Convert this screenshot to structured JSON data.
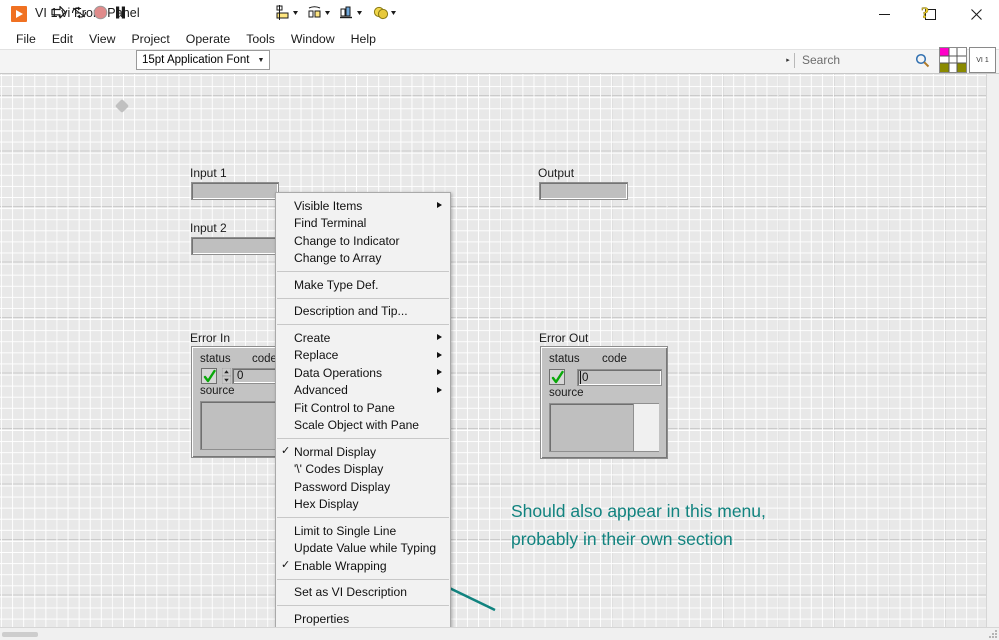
{
  "window": {
    "title": "VI 1.vi Front Panel",
    "app_icon": "labview-run-icon",
    "minimize_label": "Minimize",
    "maximize_label": "Maximize",
    "close_label": "Close"
  },
  "menubar": {
    "items": [
      {
        "label": "File"
      },
      {
        "label": "Edit"
      },
      {
        "label": "View"
      },
      {
        "label": "Project"
      },
      {
        "label": "Operate"
      },
      {
        "label": "Tools"
      },
      {
        "label": "Window"
      },
      {
        "label": "Help"
      }
    ]
  },
  "toolbar": {
    "run_label": "Run",
    "run_continuously_label": "Run Continuously",
    "abort_label": "Abort Execution",
    "pause_label": "Pause",
    "font_selector": {
      "value": "15pt Application Font",
      "caret": "▼"
    },
    "align_label": "Align Objects",
    "distribute_label": "Distribute Objects",
    "resize_label": "Resize Objects",
    "reorder_label": "Reorder",
    "search": {
      "placeholder": "Search",
      "expander": "▸"
    },
    "help_label": "Context Help",
    "connector_pane_label": "Connector Pane",
    "vi_icon_label": "VI 1"
  },
  "canvas": {
    "origin_marker": "origin-marker",
    "controls": [
      {
        "id": "input1",
        "label": "Input 1"
      },
      {
        "id": "input2",
        "label": "Input 2"
      },
      {
        "id": "output",
        "label": "Output"
      },
      {
        "id": "error_in",
        "label": "Error In"
      },
      {
        "id": "error_out",
        "label": "Error Out"
      }
    ],
    "error_in": {
      "label": "Error In",
      "status_label": "status",
      "code_label": "code",
      "source_label": "source",
      "code_value": "0",
      "status_value": "no error"
    },
    "error_out": {
      "label": "Error Out",
      "status_label": "status",
      "code_label": "code",
      "source_label": "source",
      "code_value": "0",
      "status_value": "no error"
    }
  },
  "context_menu": {
    "groups": [
      {
        "items": [
          {
            "label": "Visible Items",
            "submenu": true,
            "checked": false
          },
          {
            "label": "Find Terminal",
            "submenu": false,
            "checked": false
          },
          {
            "label": "Change to Indicator",
            "submenu": false,
            "checked": false
          },
          {
            "label": "Change to Array",
            "submenu": false,
            "checked": false
          }
        ]
      },
      {
        "items": [
          {
            "label": "Make Type Def.",
            "submenu": false,
            "checked": false
          }
        ]
      },
      {
        "items": [
          {
            "label": "Description and Tip...",
            "submenu": false,
            "checked": false
          }
        ]
      },
      {
        "items": [
          {
            "label": "Create",
            "submenu": true,
            "checked": false
          },
          {
            "label": "Replace",
            "submenu": true,
            "checked": false
          },
          {
            "label": "Data Operations",
            "submenu": true,
            "checked": false
          },
          {
            "label": "Advanced",
            "submenu": true,
            "checked": false
          },
          {
            "label": "Fit Control to Pane",
            "submenu": false,
            "checked": false
          },
          {
            "label": "Scale Object with Pane",
            "submenu": false,
            "checked": false
          }
        ]
      },
      {
        "items": [
          {
            "label": "Normal Display",
            "submenu": false,
            "checked": true
          },
          {
            "label": "'\\' Codes Display",
            "submenu": false,
            "checked": false
          },
          {
            "label": "Password Display",
            "submenu": false,
            "checked": false
          },
          {
            "label": "Hex Display",
            "submenu": false,
            "checked": false
          }
        ]
      },
      {
        "items": [
          {
            "label": "Limit to Single Line",
            "submenu": false,
            "checked": false
          },
          {
            "label": "Update Value while Typing",
            "submenu": false,
            "checked": false
          },
          {
            "label": "Enable Wrapping",
            "submenu": false,
            "checked": true
          }
        ]
      },
      {
        "items": [
          {
            "label": "Set as VI Description",
            "submenu": false,
            "checked": false
          }
        ]
      },
      {
        "items": [
          {
            "label": "Properties",
            "submenu": false,
            "checked": false
          }
        ]
      }
    ]
  },
  "annotation": {
    "line1": "Should also appear in this menu,",
    "line2": "probably in their own section",
    "color": "#11837f",
    "arrow": "annotation-arrow"
  }
}
